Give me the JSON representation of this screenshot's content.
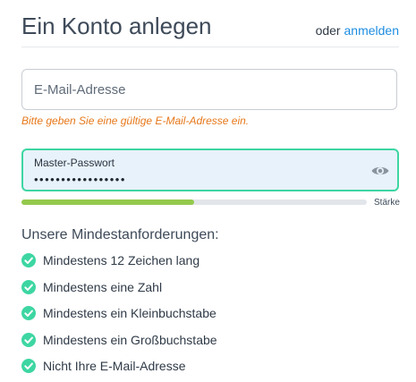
{
  "header": {
    "title": "Ein Konto anlegen",
    "or_text": "oder",
    "login_link": "anmelden"
  },
  "email": {
    "placeholder": "E-Mail-Adresse",
    "value": "",
    "error": "Bitte geben Sie eine gültige E-Mail-Adresse ein."
  },
  "password": {
    "label": "Master-Passwort",
    "masked_value": "•••••••••••••••••",
    "toggle_icon": "eye-icon"
  },
  "strength": {
    "label": "Stärke",
    "level_fraction": 0.5,
    "color": "#94c94d"
  },
  "requirements": {
    "heading": "Unsere Mindestanforderungen:",
    "items": [
      {
        "label": "Mindestens 12 Zeichen lang",
        "met": true
      },
      {
        "label": "Mindestens eine Zahl",
        "met": true
      },
      {
        "label": "Mindestens ein Kleinbuchstabe",
        "met": true
      },
      {
        "label": "Mindestens ein Großbuchstabe",
        "met": true
      },
      {
        "label": "Nicht Ihre E-Mail-Adresse",
        "met": true
      }
    ]
  },
  "colors": {
    "accent_link": "#1c8de0",
    "error": "#e6781a",
    "focus_border": "#3dd6a2",
    "check": "#3dd6a2"
  }
}
